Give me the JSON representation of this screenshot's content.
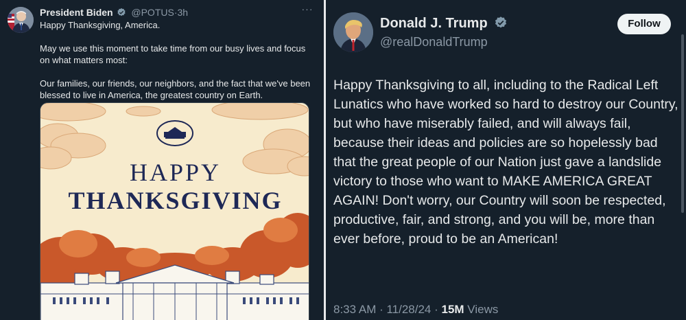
{
  "left_tweet": {
    "display_name": "President Biden",
    "handle": "@POTUS",
    "separator": "·",
    "time": "3h",
    "more_icon": "more-icon",
    "paragraphs": [
      "Happy Thanksgiving, America.",
      "May we use this moment to take time from our busy lives and focus on what matters most:",
      "Our families, our friends, our neighbors, and the fact that we've been blessed to live in America, the greatest country on Earth."
    ],
    "image": {
      "title_line1": "HAPPY",
      "title_line2": "THANKSGIVING"
    }
  },
  "right_tweet": {
    "display_name": "Donald J. Trump",
    "handle": "@realDonaldTrump",
    "follow_label": "Follow",
    "text": "Happy Thanksgiving to all, including to the Radical Left Lunatics who have worked so hard to destroy our Country, but who have miserably failed, and will always fail, because their ideas and policies are so hopelessly bad that the great people of our Nation just gave a landslide victory to those who want to MAKE AMERICA GREAT AGAIN! Don't worry, our Country will soon be respected, productive, fair, and strong, and you will be, more than ever before, proud to be an American!",
    "time": "8:33 AM · 11/28/24 · ",
    "views_count": "15M",
    "views_label": " Views"
  },
  "colors": {
    "background": "#15202b",
    "text": "#e7e9ea",
    "secondary_text": "#8b98a5",
    "verified": "#829aab",
    "card_navy": "#1e2856",
    "foliage": "#c9582a"
  }
}
